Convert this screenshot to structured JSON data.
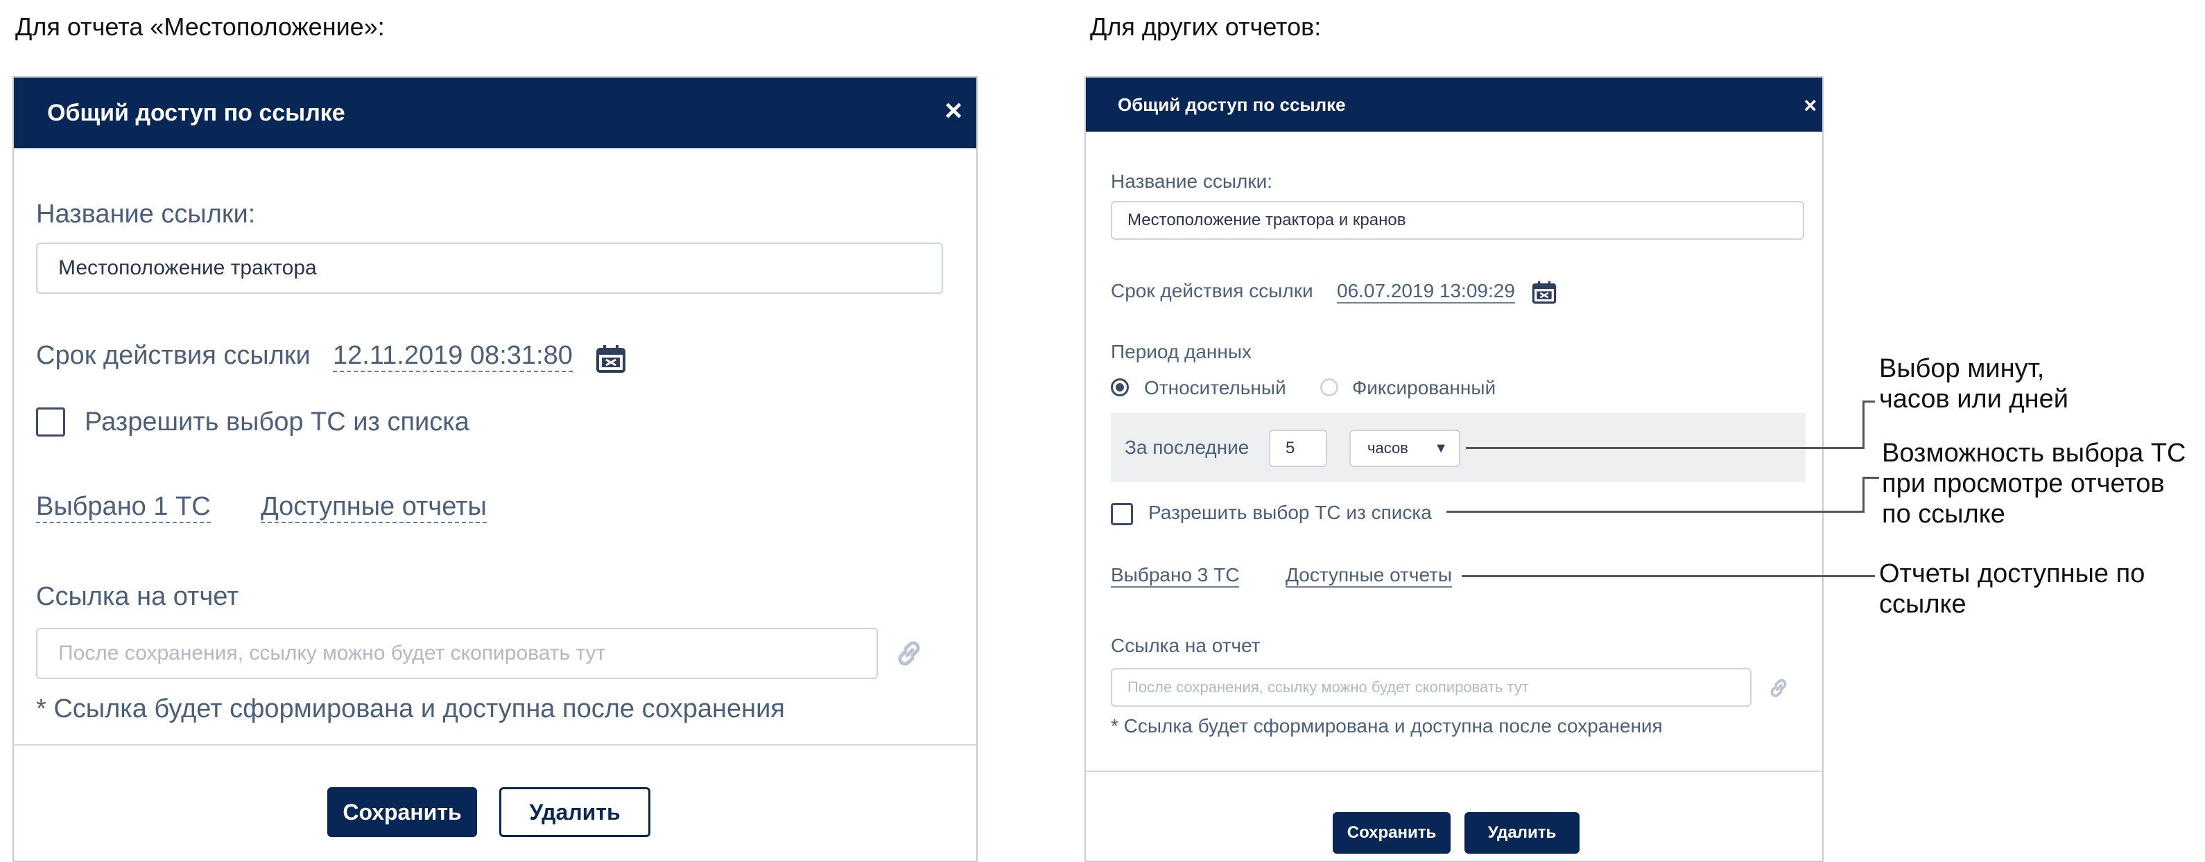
{
  "captions": {
    "left": "Для отчета «Местоположение»:",
    "right": "Для других отчетов:"
  },
  "left_dialog": {
    "title": "Общий доступ по ссылке",
    "close": "×",
    "link_name_label": "Название ссылки:",
    "link_name_value": "Местоположение трактора",
    "expiry_label": "Срок действия ссылки",
    "expiry_value": "12.11.2019 08:31:80",
    "allow_select_label": "Разрешить выбор ТС из списка",
    "selected_link": "Выбрано 1 ТС",
    "reports_link": "Доступные отчеты",
    "report_link_label": "Ссылка на отчет",
    "report_link_placeholder": "После сохранения, ссылку можно будет скопировать тут",
    "note": "* Ссылка будет сформирована и доступна после сохранения",
    "save": "Сохранить",
    "delete": "Удалить"
  },
  "right_dialog": {
    "title": "Общий доступ по ссылке",
    "close": "×",
    "link_name_label": "Название ссылки:",
    "link_name_value": "Местоположение трактора и кранов",
    "expiry_label": "Срок действия ссылки",
    "expiry_value": "06.07.2019 13:09:29",
    "period_label": "Период данных",
    "radio_relative": "Относительный",
    "radio_fixed": "Фиксированный",
    "last_label": "За последние",
    "last_value": "5",
    "unit_value": "часов",
    "unit_arrow": "▼",
    "allow_select_label": "Разрешить выбор ТС из списка",
    "selected_link": "Выбрано 3 ТС",
    "reports_link": "Доступные отчеты",
    "report_link_label": "Ссылка на отчет",
    "report_link_placeholder": "После сохранения, ссылку можно будет скопировать тут",
    "note": "* Ссылка будет сформирована и доступна после сохранения",
    "save": "Сохранить",
    "delete": "Удалить"
  },
  "annotations": {
    "units": "Выбор минут,\nчасов или дней",
    "select": "Возможность выбора ТС\nпри просмотре отчетов\nпо ссылке",
    "reports": "Отчеты доступные по\nссылке"
  },
  "icons": {
    "calendar": "calendar-icon",
    "link": "link-icon",
    "close": "close-icon"
  },
  "colors": {
    "header": "#082656",
    "accent": "#082656"
  }
}
